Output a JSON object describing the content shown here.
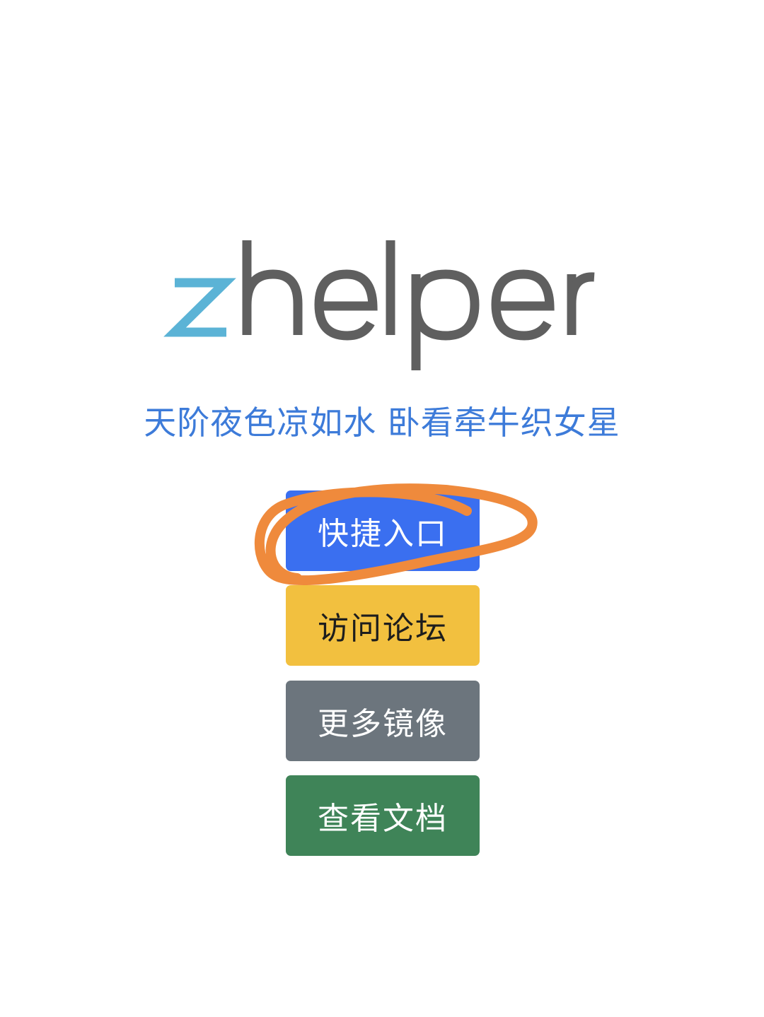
{
  "logo": {
    "prefix": "z",
    "rest": "helper",
    "prefix_color": "#5bb3d6",
    "rest_color": "#5f5f5f"
  },
  "slogan": "天阶夜色凉如水 卧看牵牛织女星",
  "buttons": [
    {
      "label": "快捷入口",
      "color": "#3a6ff0"
    },
    {
      "label": "访问论坛",
      "color": "#f2c03f"
    },
    {
      "label": "更多镜像",
      "color": "#6c757d"
    },
    {
      "label": "查看文档",
      "color": "#3f8458"
    }
  ],
  "annotation": {
    "color": "#ef8a3c"
  }
}
